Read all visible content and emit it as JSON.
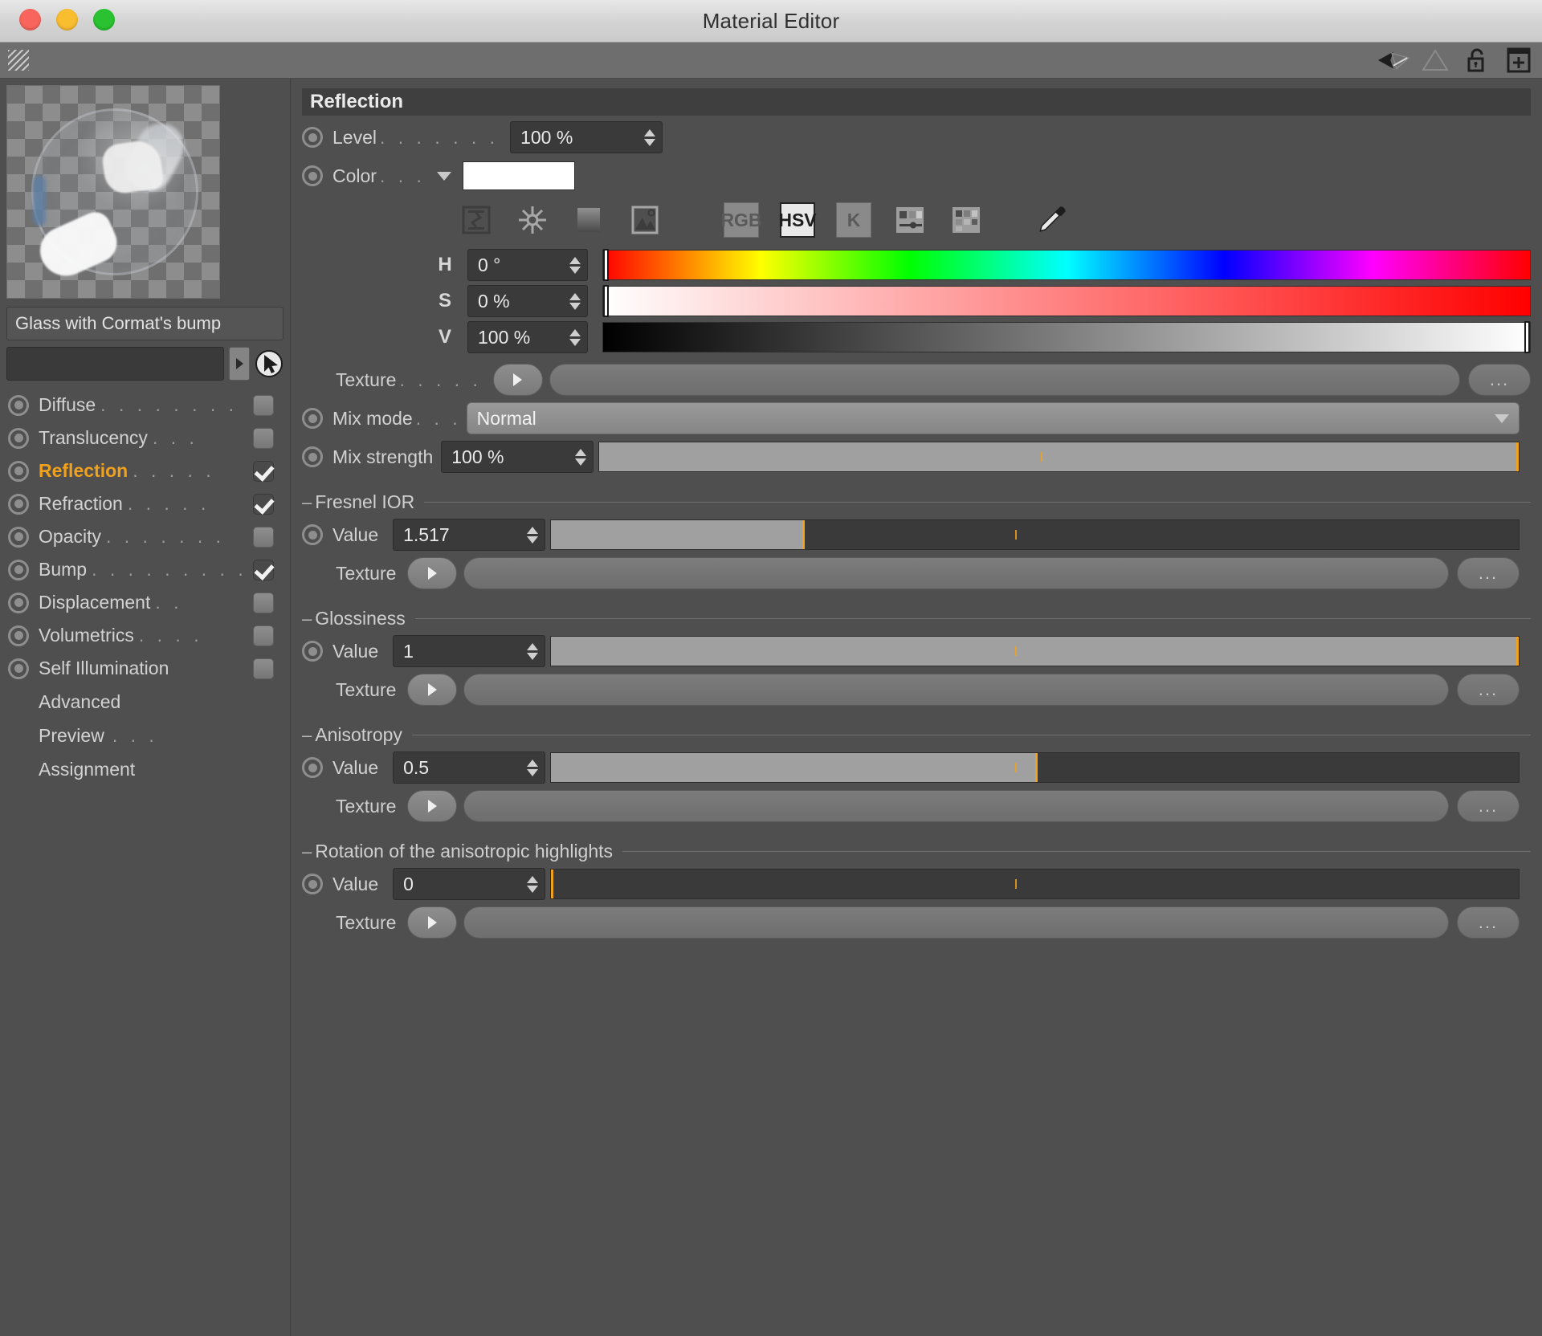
{
  "window": {
    "title": "Material Editor",
    "traffic_lights": [
      "close",
      "minimize",
      "zoom"
    ]
  },
  "toolbar": {
    "icons": [
      "grip-handle-icon",
      "back-arrow-icon",
      "wireframe-icon",
      "triangle-icon",
      "lock-open-icon",
      "new-panel-icon"
    ]
  },
  "sidebar": {
    "preview_name": "material-preview-sphere",
    "material_name": "Glass with Cormat's bump",
    "search_value": "",
    "channels": [
      {
        "label": "Diffuse",
        "dots": ". . . . . . . .",
        "checked": false,
        "active": false
      },
      {
        "label": "Translucency",
        "dots": ". . .",
        "checked": false,
        "active": false
      },
      {
        "label": "Reflection",
        "dots": ". . . . .",
        "checked": true,
        "active": true
      },
      {
        "label": "Refraction",
        "dots": ". . . . .",
        "checked": true,
        "active": false
      },
      {
        "label": "Opacity",
        "dots": ". . . . . . .",
        "checked": false,
        "active": false
      },
      {
        "label": "Bump",
        "dots": ". . . . . . . . .",
        "checked": true,
        "active": false
      },
      {
        "label": "Displacement",
        "dots": ". .",
        "checked": false,
        "active": false
      },
      {
        "label": "Volumetrics",
        "dots": ". . . .",
        "checked": false,
        "active": false
      },
      {
        "label": "Self Illumination",
        "dots": "",
        "checked": false,
        "active": false
      }
    ],
    "plain_items": [
      {
        "label": "Advanced",
        "dots": ""
      },
      {
        "label": "Preview",
        "dots": ". . ."
      },
      {
        "label": "Assignment",
        "dots": ""
      }
    ]
  },
  "panel": {
    "section_title": "Reflection",
    "level": {
      "label": "Level",
      "dots": ". . . . . . .",
      "value": "100 %"
    },
    "color": {
      "label": "Color",
      "dots": ". . .",
      "hex": "#ffffff"
    },
    "color_modes": {
      "icons": [
        "range-icon",
        "colorwheel-icon",
        "gradient-icon",
        "image-icon"
      ],
      "buttons": [
        {
          "label": "RGB",
          "selected": false
        },
        {
          "label": "HSV",
          "selected": true
        },
        {
          "label": "K",
          "selected": false
        }
      ],
      "extra_icons": [
        "sliders-icon",
        "swatches-icon",
        "eyedropper-icon"
      ]
    },
    "hsv": [
      {
        "letter": "H",
        "value": "0 °",
        "knob_pct": 0
      },
      {
        "letter": "S",
        "value": "0 %",
        "knob_pct": 0
      },
      {
        "letter": "V",
        "value": "100 %",
        "knob_pct": 100
      }
    ],
    "color_texture": {
      "label": "Texture",
      "dots": ". . . . .",
      "value": "",
      "more_label": "..."
    },
    "mix_mode": {
      "label": "Mix mode",
      "dots": ". . .",
      "value": "Normal"
    },
    "mix_strength": {
      "label": "Mix strength",
      "value": "100 %",
      "fill_pct": 100,
      "tick_pct": 48
    },
    "groups": [
      {
        "title": "Fresnel IOR",
        "value_label": "Value",
        "value": "1.517",
        "fill_pct": 26,
        "tick_pct": 48,
        "texture_label": "Texture",
        "texture_value": "",
        "more_label": "..."
      },
      {
        "title": "Glossiness",
        "value_label": "Value",
        "value": "1",
        "fill_pct": 100,
        "tick_pct": 48,
        "texture_label": "Texture",
        "texture_value": "",
        "more_label": "..."
      },
      {
        "title": "Anisotropy",
        "value_label": "Value",
        "value": "0.5",
        "fill_pct": 50,
        "tick_pct": 48,
        "texture_label": "Texture",
        "texture_value": "",
        "more_label": "..."
      },
      {
        "title": "Rotation of the anisotropic highlights",
        "value_label": "Value",
        "value": "0",
        "fill_pct": 0,
        "tick_pct": 48,
        "texture_label": "Texture",
        "texture_value": "",
        "more_label": "..."
      }
    ]
  },
  "colors": {
    "accent": "#f0a11e",
    "panel_bg": "#4f4f4f",
    "section_bg": "#3f3f3f",
    "field_bg": "#3a3a3a",
    "text": "#d2d2d2"
  }
}
